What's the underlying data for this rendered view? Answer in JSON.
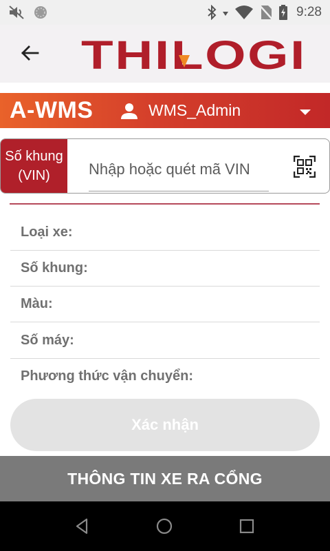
{
  "status_bar": {
    "time": "9:28",
    "icons": [
      "mute-icon",
      "sync-icon",
      "bluetooth-icon",
      "data-arrow-icon",
      "wifi-icon",
      "no-sim-icon",
      "battery-icon"
    ]
  },
  "header": {
    "logo_text": "THILOGI",
    "back_icon": "arrow-left-icon"
  },
  "app_bar": {
    "app_name": "A-WMS",
    "user_name": "WMS_Admin",
    "user_icon": "person-icon",
    "dropdown_icon": "chevron-down-icon"
  },
  "vin": {
    "label_line1": "Số khung",
    "label_line2": "(VIN)",
    "placeholder": "Nhập hoặc quét mã VIN",
    "value": "",
    "scan_icon": "qr-code-icon"
  },
  "details": {
    "fields": [
      {
        "label": "Loại xe:"
      },
      {
        "label": "Số khung:"
      },
      {
        "label": "Màu:"
      },
      {
        "label": "Số máy:"
      },
      {
        "label": "Phương thức vận chuyển:"
      }
    ]
  },
  "confirm_label": "Xác nhận",
  "banner_title": "THÔNG TIN XE RA CỔNG",
  "nav": {
    "back": "nav-back-icon",
    "home": "nav-home-icon",
    "recents": "nav-recents-icon"
  },
  "colors": {
    "brand_red": "#b0202a",
    "bar_gradient_start": "#e9622a",
    "bar_gradient_end": "#c22828",
    "button_disabled": "#e3e3e3",
    "banner_gray": "#7a7a7a"
  }
}
